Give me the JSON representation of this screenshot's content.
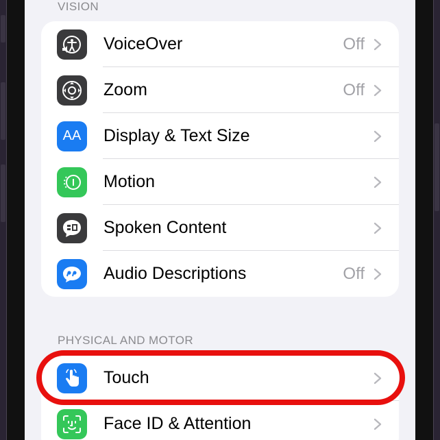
{
  "vision_section": {
    "header": "VISION",
    "items": [
      {
        "label": "VoiceOver",
        "value": "Off",
        "icon": "voiceover-icon",
        "icon_color": "#3a3a3c"
      },
      {
        "label": "Zoom",
        "value": "Off",
        "icon": "zoom-icon",
        "icon_color": "#3a3a3c"
      },
      {
        "label": "Display & Text Size",
        "value": "",
        "icon": "display-text-size-icon",
        "icon_color": "#1a7cf2"
      },
      {
        "label": "Motion",
        "value": "",
        "icon": "motion-icon",
        "icon_color": "#34c759"
      },
      {
        "label": "Spoken Content",
        "value": "",
        "icon": "spoken-content-icon",
        "icon_color": "#3a3a3c"
      },
      {
        "label": "Audio Descriptions",
        "value": "Off",
        "icon": "audio-descriptions-icon",
        "icon_color": "#1a7cf2"
      }
    ]
  },
  "physical_section": {
    "header": "PHYSICAL AND MOTOR",
    "items": [
      {
        "label": "Touch",
        "value": "",
        "icon": "touch-icon",
        "icon_color": "#1a7cf2"
      },
      {
        "label": "Face ID & Attention",
        "value": "",
        "icon": "face-id-icon",
        "icon_color": "#34c759"
      }
    ]
  },
  "display_icon_text": "AA",
  "highlight_color": "#e8100e"
}
